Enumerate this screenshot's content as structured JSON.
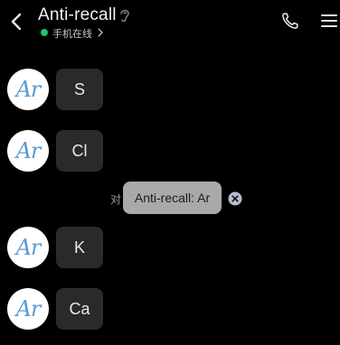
{
  "header": {
    "title": "Anti-recall",
    "status": "手机在线",
    "icons": {
      "back": "back-chevron-icon",
      "ear": "ear-icon",
      "phone": "phone-icon",
      "menu": "menu-icon"
    }
  },
  "messages": [
    {
      "avatar": "Ar",
      "text": "S"
    },
    {
      "avatar": "Ar",
      "text": "Cl"
    },
    {
      "avatar": "Ar",
      "text": "K"
    },
    {
      "avatar": "Ar",
      "text": "Ca"
    }
  ],
  "recall_notice": {
    "prefix": "对",
    "chip_text": "Anti-recall: Ar"
  },
  "colors": {
    "background": "#000000",
    "status_dot": "#21c16b",
    "bubble": "#2a2a2a",
    "avatar_text": "#5b9bd5",
    "chip": "#a9a9a9"
  }
}
